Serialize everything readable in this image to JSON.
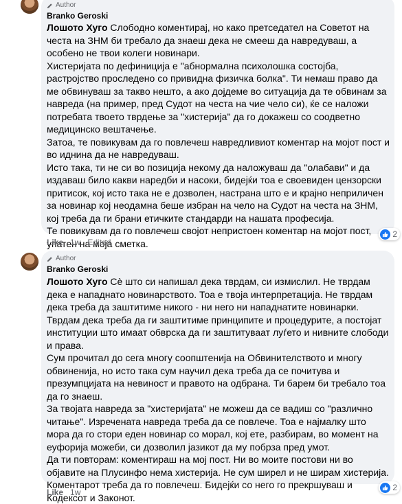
{
  "comments": [
    {
      "badge": "Author",
      "author": "Branko Geroski",
      "paragraphs": [
        {
          "mention": "Лошото Хуго",
          "text": " Слободно коментирај, но како претседател на Советот на честа на ЗНМ би требало да знаеш дека не смееш да навредуваш, а особено не твои колеги новинари."
        },
        {
          "mention": "",
          "text": "Хистеријата по дефиниција е \"абнормална психолошка состојба, растројство проследено со привидна физичка болка\". Ти немаш право да ме обвинуваш за такво нешто, а ако дојдеме во ситуација да те обвинам за навреда (на пример, пред Судот на честа на чие чело си), ќе се наложи потребата твоето тврдење за \"хистерија\" да го докажеш со соодветно медицинско вештачење."
        },
        {
          "mention": "",
          "text": "Затоа, те повикувам да го повлечеш навредливиот коментар на мојот пост и во иднина да не навредуваш."
        },
        {
          "mention": "",
          "text": "Исто така, ти не си во позиција некому да наложуваш да \"олабави\" и да издаваш било какви наредби и насоки, бидејќи тоа е своевиден цензорски притисок, кој исто така не е дозволен, настрана што е и крајно неприличен за новинар кој неодамна беше избран на чело на Судот на честа на ЗНМ, кој треба да ги брани етичките стандарди на нашата професија."
        },
        {
          "mention": "",
          "text": "Те повикувам да го повлечеш својот непристоен коментар на мојот пост, упатен на моја сметка."
        }
      ],
      "actions": {
        "like": "Like",
        "time": "1w",
        "edited": "Edited"
      },
      "reaction_count": "2"
    },
    {
      "badge": "Author",
      "author": "Branko Geroski",
      "paragraphs": [
        {
          "mention": "Лошото Хуго",
          "text": " Сè што си напишал дека тврдам, си измислил. Не тврдам дека е нападнато новинарството. Тоа е твоја интерпретација. Не тврдам дека треба да заштитиме никого - ни него ни нападнатите новинарки. Тврдам дека треба да ги заштитиме принципите и процедурите, а постојат институции што имаат обврска да ги заштитуваат луѓето и нивните слободи и права."
        },
        {
          "mention": "",
          "text": "Сум прочитал до сега многу соопштенија на Обвинителството и многу обвиненија, но исто така сум научил дека треба да се почитува и презумпцијата на невиност и правото на одбрана. Ти барем би требало тоа да го знаеш."
        },
        {
          "mention": "",
          "text": "За твојата навреда за \"хистеријата\" не можеш да се вадиш со \"различно читање\". Изречената навреда треба да се повлече. Тоа е најмалку што мора да го стори еден новинар со морал, кој ете, разбирам, во момент на еуфорија можеби, си дозволил јазикот да му побрза пред умот."
        },
        {
          "mention": "",
          "text": "Да ти повторам: коментираш на мој пост. Ни во моите постови ни во објавите на Плусинфо нема хистерија. Не сум ширел и не ширам хистерија. Коментарот треба да го повлечеш. Бидејќи со него го прекршуваш и Кодексот и Законот."
        }
      ],
      "actions": {
        "like": "Like",
        "time": "1w",
        "edited": ""
      },
      "reaction_count": "2"
    }
  ]
}
